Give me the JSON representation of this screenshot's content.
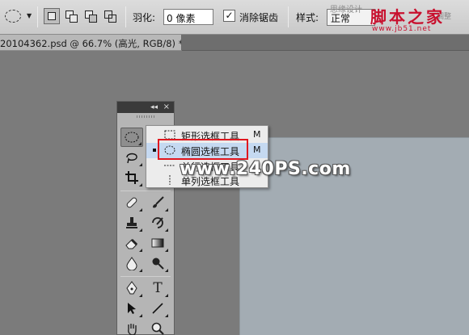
{
  "options_bar": {
    "feather_label": "羽化:",
    "feather_value": "0 像素",
    "antialias_label": "消除锯齿",
    "antialias_checked": "✓",
    "style_label": "样式:",
    "style_value": "正常",
    "faded_caption": "思缘设计",
    "faded_right": "调整"
  },
  "watermark_logo": {
    "text": "脚本之家",
    "url": "www.jb51.net"
  },
  "document_tab": {
    "title": "20104362.psd @ 66.7% (高光, RGB/8) *",
    "close": "×"
  },
  "tools_panel": {
    "collapse": "◂◂",
    "close": "×"
  },
  "flyout_menu": {
    "items": [
      {
        "label": "矩形选框工具",
        "shortcut": "M",
        "icon": "rect-marquee-icon",
        "selected": false
      },
      {
        "label": "椭圆选框工具",
        "shortcut": "M",
        "icon": "ellipse-marquee-icon",
        "selected": true
      },
      {
        "label": "单行选框工具",
        "shortcut": "",
        "icon": "single-row-marquee-icon",
        "selected": false
      },
      {
        "label": "单列选框工具",
        "shortcut": "",
        "icon": "single-column-marquee-icon",
        "selected": false
      }
    ]
  },
  "overlay_watermark": "www.240PS.com",
  "colors": {
    "workspace": "#7b7b7b",
    "canvas": "#a3acb3",
    "menu_highlight": "#c5d9f1",
    "annotation_red": "#e0171f",
    "logo_red": "#c8102e"
  }
}
